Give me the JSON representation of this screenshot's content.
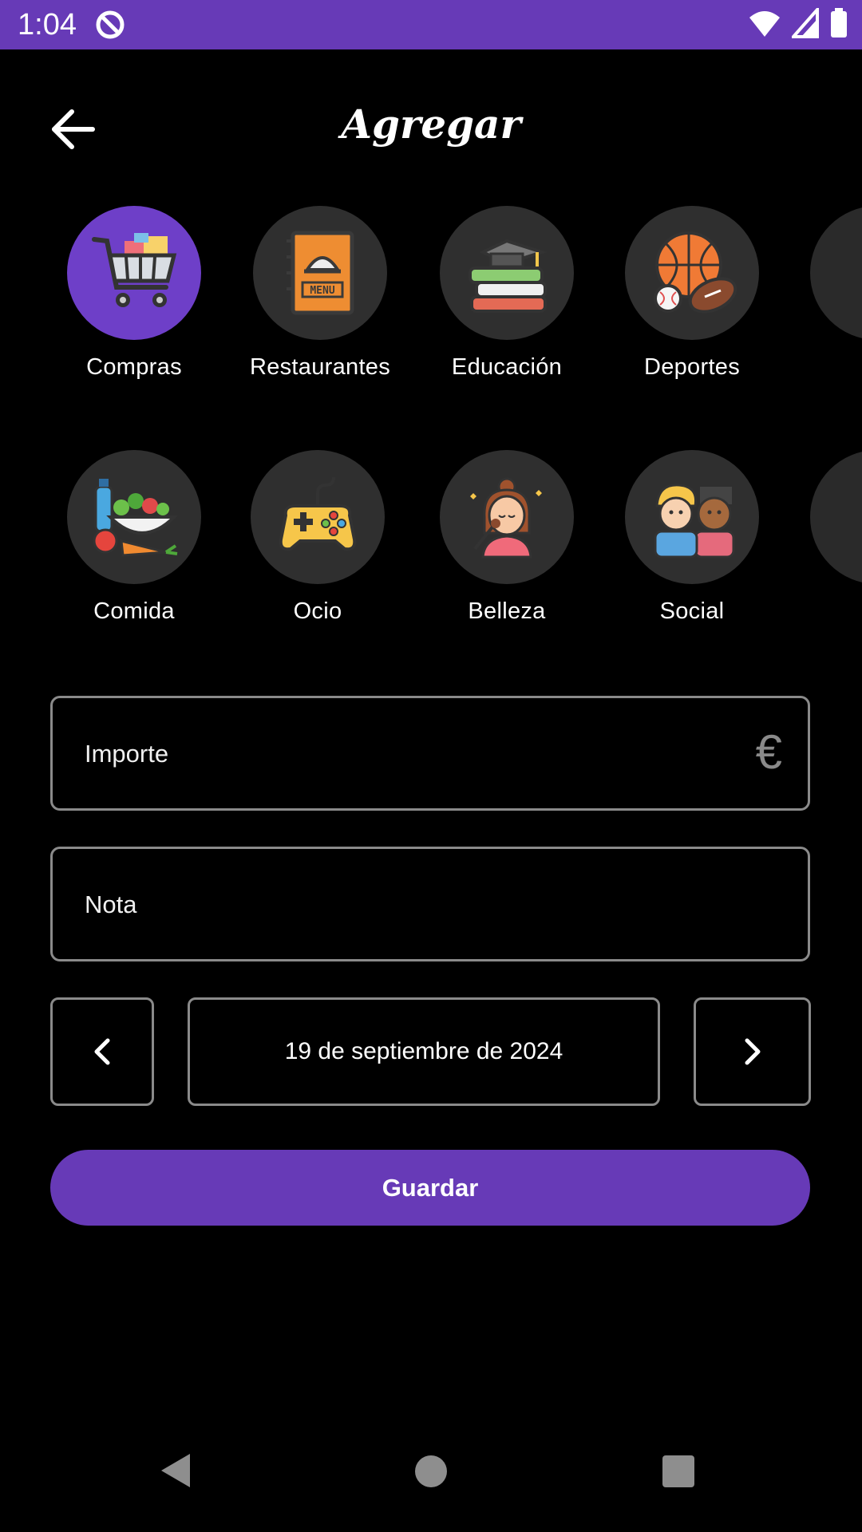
{
  "status_bar": {
    "time": "1:04",
    "icons": [
      "focus-mode-icon",
      "wifi-icon",
      "signal-icon",
      "battery-icon"
    ],
    "color": "#673AB7"
  },
  "header": {
    "title": "Agregar",
    "back_icon": "arrow-left-icon"
  },
  "categories": {
    "row1": [
      {
        "label": "Compras",
        "icon": "shopping-cart-icon",
        "selected": true
      },
      {
        "label": "Restaurantes",
        "icon": "restaurant-menu-icon",
        "selected": false
      },
      {
        "label": "Educación",
        "icon": "education-books-icon",
        "selected": false
      },
      {
        "label": "Deportes",
        "icon": "sports-balls-icon",
        "selected": false
      }
    ],
    "row2": [
      {
        "label": "Comida",
        "icon": "groceries-icon",
        "selected": false
      },
      {
        "label": "Ocio",
        "icon": "gamepad-icon",
        "selected": false
      },
      {
        "label": "Belleza",
        "icon": "beauty-makeup-icon",
        "selected": false
      },
      {
        "label": "Social",
        "icon": "friends-icon",
        "selected": false
      }
    ]
  },
  "form": {
    "amount_placeholder": "Importe",
    "currency_symbol": "€",
    "note_placeholder": "Nota",
    "date": "19 de septiembre de 2024",
    "save_label": "Guardar"
  },
  "colors": {
    "accent": "#673AB7",
    "background": "#000000",
    "field_border": "#8A8A8A",
    "category_circle": "#2F2F2F"
  },
  "nav_bar": {
    "icons": [
      "nav-back-icon",
      "nav-home-icon",
      "nav-recents-icon"
    ]
  }
}
